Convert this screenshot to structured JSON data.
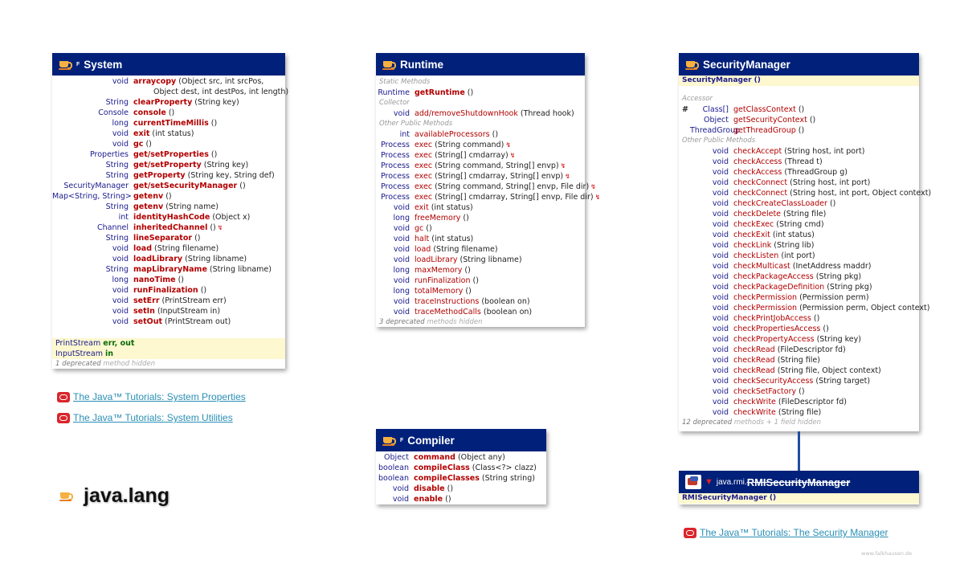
{
  "page": {
    "title": "java.lang",
    "credit": "www.falkhausen.de"
  },
  "system": {
    "name": "System",
    "final": "F",
    "methods": [
      {
        "type": "void",
        "name": "arraycopy",
        "params": "(Object src, int srcPos,",
        "bold": true
      },
      {
        "type": "",
        "name": "",
        "params": "Object dest, int destPos, int length)",
        "bold": false
      },
      {
        "type": "String",
        "name": "clearProperty",
        "params": "(String key)",
        "bold": true
      },
      {
        "type": "Console",
        "name": "console",
        "params": "()",
        "bold": true
      },
      {
        "type": "long",
        "name": "currentTimeMillis",
        "params": "()",
        "bold": true
      },
      {
        "type": "void",
        "name": "exit",
        "params": "(int status)",
        "bold": true
      },
      {
        "type": "void",
        "name": "gc",
        "params": "()",
        "bold": true
      },
      {
        "type": "Properties",
        "name": "get/setProperties",
        "params": "()",
        "bold": true
      },
      {
        "type": "String",
        "name": "get/setProperty",
        "params": "(String key)",
        "bold": true
      },
      {
        "type": "String",
        "name": "getProperty",
        "params": "(String key, String def)",
        "bold": true
      },
      {
        "type": "SecurityManager",
        "name": "get/setSecurityManager",
        "params": "()",
        "bold": true
      },
      {
        "type": "Map<String, String>",
        "name": "getenv",
        "params": "()",
        "bold": true
      },
      {
        "type": "String",
        "name": "getenv",
        "params": "(String name)",
        "bold": true
      },
      {
        "type": "int",
        "name": "identityHashCode",
        "params": "(Object x)",
        "bold": true
      },
      {
        "type": "Channel",
        "name": "inheritedChannel",
        "params": "()",
        "bold": true,
        "dep": "↯"
      },
      {
        "type": "String",
        "name": "lineSeparator",
        "params": "()",
        "bold": true
      },
      {
        "type": "void",
        "name": "load",
        "params": "(String filename)",
        "bold": true
      },
      {
        "type": "void",
        "name": "loadLibrary",
        "params": "(String libname)",
        "bold": true
      },
      {
        "type": "String",
        "name": "mapLibraryName",
        "params": "(String libname)",
        "bold": true
      },
      {
        "type": "long",
        "name": "nanoTime",
        "params": "()",
        "bold": true
      },
      {
        "type": "void",
        "name": "runFinalization",
        "params": "()",
        "bold": true
      },
      {
        "type": "void",
        "name": "setErr",
        "params": "(PrintStream err)",
        "bold": true
      },
      {
        "type": "void",
        "name": "setIn",
        "params": "(InputStream in)",
        "bold": true
      },
      {
        "type": "void",
        "name": "setOut",
        "params": "(PrintStream out)",
        "bold": true
      }
    ],
    "fields": [
      {
        "type": "PrintStream",
        "names": "err, out"
      },
      {
        "type": "InputStream",
        "names": "in"
      }
    ],
    "note": {
      "count": "1 deprecated",
      "rest": "method hidden"
    }
  },
  "runtime": {
    "name": "Runtime",
    "sections": [
      {
        "label": "Static Methods",
        "rows": [
          {
            "type": "Runtime",
            "name": "getRuntime",
            "params": "()",
            "bold": true
          }
        ]
      },
      {
        "label": "Collector",
        "rows": [
          {
            "type": "void",
            "name": "add/removeShutdownHook",
            "params": "(Thread hook)",
            "bold": false
          }
        ]
      },
      {
        "label": "Other Public Methods",
        "rows": [
          {
            "type": "int",
            "name": "availableProcessors",
            "params": "()",
            "bold": false
          },
          {
            "type": "Process",
            "name": "exec",
            "params": "(String command)",
            "bold": false,
            "dep": "↯"
          },
          {
            "type": "Process",
            "name": "exec",
            "params": "(String[] cmdarray)",
            "bold": false,
            "dep": "↯"
          },
          {
            "type": "Process",
            "name": "exec",
            "params": "(String command, String[] envp)",
            "bold": false,
            "dep": "↯"
          },
          {
            "type": "Process",
            "name": "exec",
            "params": "(String[] cmdarray, String[] envp)",
            "bold": false,
            "dep": "↯"
          },
          {
            "type": "Process",
            "name": "exec",
            "params": "(String command, String[] envp, File dir)",
            "bold": false,
            "dep": "↯"
          },
          {
            "type": "Process",
            "name": "exec",
            "params": "(String[] cmdarray, String[] envp, File dir)",
            "bold": false,
            "dep": "↯"
          },
          {
            "type": "void",
            "name": "exit",
            "params": "(int status)",
            "bold": false
          },
          {
            "type": "long",
            "name": "freeMemory",
            "params": "()",
            "bold": false
          },
          {
            "type": "void",
            "name": "gc",
            "params": "()",
            "bold": false
          },
          {
            "type": "void",
            "name": "halt",
            "params": "(int status)",
            "bold": false
          },
          {
            "type": "void",
            "name": "load",
            "params": "(String filename)",
            "bold": false
          },
          {
            "type": "void",
            "name": "loadLibrary",
            "params": "(String libname)",
            "bold": false
          },
          {
            "type": "long",
            "name": "maxMemory",
            "params": "()",
            "bold": false
          },
          {
            "type": "void",
            "name": "runFinalization",
            "params": "()",
            "bold": false
          },
          {
            "type": "long",
            "name": "totalMemory",
            "params": "()",
            "bold": false
          },
          {
            "type": "void",
            "name": "traceInstructions",
            "params": "(boolean on)",
            "bold": false
          },
          {
            "type": "void",
            "name": "traceMethodCalls",
            "params": "(boolean on)",
            "bold": false
          }
        ]
      }
    ],
    "note": {
      "count": "3 deprecated",
      "rest": "methods hidden"
    }
  },
  "compiler": {
    "name": "Compiler",
    "final": "F",
    "methods": [
      {
        "type": "Object",
        "name": "command",
        "params": "(Object any)",
        "bold": true
      },
      {
        "type": "boolean",
        "name": "compileClass",
        "params": "(Class<?> clazz)",
        "bold": true
      },
      {
        "type": "boolean",
        "name": "compileClasses",
        "params": "(String string)",
        "bold": true
      },
      {
        "type": "void",
        "name": "disable",
        "params": "()",
        "bold": true
      },
      {
        "type": "void",
        "name": "enable",
        "params": "()",
        "bold": true
      }
    ]
  },
  "security": {
    "name": "SecurityManager",
    "constructor": "SecurityManager ()",
    "sections": [
      {
        "label": "Accessor",
        "rows": [
          {
            "mark": "#",
            "type": "Class[]",
            "name": "getClassContext",
            "params": "()"
          },
          {
            "mark": "",
            "type": "Object",
            "name": "getSecurityContext",
            "params": "()"
          },
          {
            "mark": "",
            "type": "ThreadGroup",
            "name": "getThreadGroup",
            "params": "()"
          }
        ]
      },
      {
        "label": "Other Public Methods",
        "rows": [
          {
            "type": "void",
            "name": "checkAccept",
            "params": "(String host, int port)"
          },
          {
            "type": "void",
            "name": "checkAccess",
            "params": "(Thread t)"
          },
          {
            "type": "void",
            "name": "checkAccess",
            "params": "(ThreadGroup g)"
          },
          {
            "type": "void",
            "name": "checkConnect",
            "params": "(String host, int port)"
          },
          {
            "type": "void",
            "name": "checkConnect",
            "params": "(String host, int port, Object context)"
          },
          {
            "type": "void",
            "name": "checkCreateClassLoader",
            "params": "()"
          },
          {
            "type": "void",
            "name": "checkDelete",
            "params": "(String file)"
          },
          {
            "type": "void",
            "name": "checkExec",
            "params": "(String cmd)"
          },
          {
            "type": "void",
            "name": "checkExit",
            "params": "(int status)"
          },
          {
            "type": "void",
            "name": "checkLink",
            "params": "(String lib)"
          },
          {
            "type": "void",
            "name": "checkListen",
            "params": "(int port)"
          },
          {
            "type": "void",
            "name": "checkMulticast",
            "params": "(InetAddress maddr)"
          },
          {
            "type": "void",
            "name": "checkPackageAccess",
            "params": "(String pkg)"
          },
          {
            "type": "void",
            "name": "checkPackageDefinition",
            "params": "(String pkg)"
          },
          {
            "type": "void",
            "name": "checkPermission",
            "params": "(Permission perm)"
          },
          {
            "type": "void",
            "name": "checkPermission",
            "params": "(Permission perm, Object context)"
          },
          {
            "type": "void",
            "name": "checkPrintJobAccess",
            "params": "()"
          },
          {
            "type": "void",
            "name": "checkPropertiesAccess",
            "params": "()"
          },
          {
            "type": "void",
            "name": "checkPropertyAccess",
            "params": "(String key)"
          },
          {
            "type": "void",
            "name": "checkRead",
            "params": "(FileDescriptor fd)"
          },
          {
            "type": "void",
            "name": "checkRead",
            "params": "(String file)"
          },
          {
            "type": "void",
            "name": "checkRead",
            "params": "(String file, Object context)"
          },
          {
            "type": "void",
            "name": "checkSecurityAccess",
            "params": "(String target)"
          },
          {
            "type": "void",
            "name": "checkSetFactory",
            "params": "()"
          },
          {
            "type": "void",
            "name": "checkWrite",
            "params": "(FileDescriptor fd)"
          },
          {
            "type": "void",
            "name": "checkWrite",
            "params": "(String file)"
          }
        ]
      }
    ],
    "note": {
      "count": "12 deprecated",
      "rest": "methods + 1 field hidden"
    }
  },
  "rmi": {
    "pkg": "java.rmi.",
    "name": "RMISecurityManager",
    "constructor": "RMISecurityManager ()"
  },
  "links": [
    {
      "text": "The Java™ Tutorials: System Properties"
    },
    {
      "text": "The Java™ Tutorials: System Utilities"
    },
    {
      "text": "The Java™ Tutorials: The Security Manager"
    }
  ],
  "colors": {
    "header": "#00207a",
    "type": "#1a1a8e",
    "method": "#b20000",
    "highlight": "#fdf8d0",
    "link": "#2a8fb5"
  }
}
